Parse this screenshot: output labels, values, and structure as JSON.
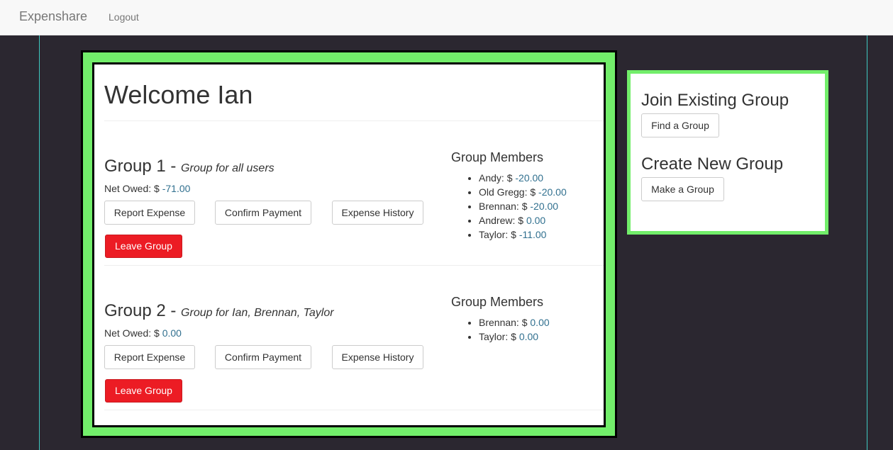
{
  "navbar": {
    "brand": "Expenshare",
    "logout": "Logout"
  },
  "welcome": "Welcome Ian",
  "labels": {
    "net_owed": "Net Owed: $ ",
    "group_members": "Group Members",
    "report_expense": "Report Expense",
    "confirm_payment": "Confirm Payment",
    "expense_history": "Expense History",
    "leave_group": "Leave Group"
  },
  "groups": [
    {
      "name": "Group 1 - ",
      "description": "Group for all users",
      "net_owed": "-71.00",
      "members": [
        {
          "name": "Andy: $ ",
          "amount": "-20.00"
        },
        {
          "name": "Old Gregg: $ ",
          "amount": "-20.00"
        },
        {
          "name": "Brennan: $ ",
          "amount": "-20.00"
        },
        {
          "name": "Andrew: $ ",
          "amount": "0.00"
        },
        {
          "name": "Taylor: $ ",
          "amount": "-11.00"
        }
      ]
    },
    {
      "name": "Group 2 - ",
      "description": "Group for Ian, Brennan, Taylor",
      "net_owed": "0.00",
      "members": [
        {
          "name": "Brennan: $ ",
          "amount": "0.00"
        },
        {
          "name": "Taylor: $ ",
          "amount": "0.00"
        }
      ]
    }
  ],
  "sidebar": {
    "join_title": "Join Existing Group",
    "find_button": "Find a Group",
    "create_title": "Create New Group",
    "make_button": "Make a Group"
  },
  "colors": {
    "accent_green": "#72ee6a",
    "danger": "#ec1c24",
    "amount": "#31708f",
    "background": "#2b2730",
    "guide_line": "#3ec9c0"
  }
}
